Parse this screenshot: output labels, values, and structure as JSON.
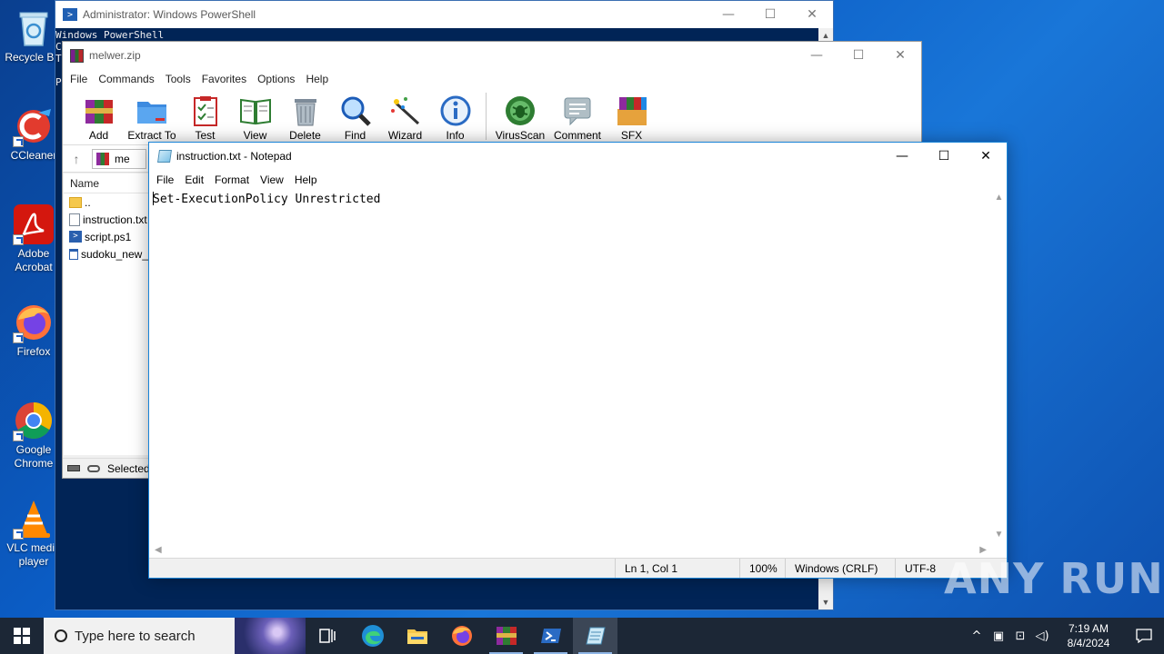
{
  "desktop": {
    "icons": [
      {
        "label": "Recycle Bin",
        "shortcut": false
      },
      {
        "label": "CCleaner",
        "shortcut": true
      },
      {
        "label": "Adobe Acrobat",
        "shortcut": true
      },
      {
        "label": "Firefox",
        "shortcut": true
      },
      {
        "label": "Google Chrome",
        "shortcut": true
      },
      {
        "label": "VLC media player",
        "shortcut": true
      }
    ]
  },
  "powershell": {
    "title": "Administrator: Windows PowerShell",
    "lines": [
      "Windows PowerShell",
      "C",
      "T",
      "",
      "P"
    ]
  },
  "winrar": {
    "title": "melwer.zip",
    "menu": [
      "File",
      "Commands",
      "Tools",
      "Favorites",
      "Options",
      "Help"
    ],
    "tools": [
      "Add",
      "Extract To",
      "Test",
      "View",
      "Delete",
      "Find",
      "Wizard",
      "Info",
      "VirusScan",
      "Comment",
      "SFX"
    ],
    "path_text": "me",
    "column_name": "Name",
    "files": [
      "..",
      "instruction.txt",
      "script.ps1",
      "sudoku_new_"
    ],
    "status": "Selected"
  },
  "notepad": {
    "title": "instruction.txt - Notepad",
    "menu": [
      "File",
      "Edit",
      "Format",
      "View",
      "Help"
    ],
    "content": "Set-ExecutionPolicy Unrestricted",
    "status": {
      "position": "Ln 1, Col 1",
      "zoom": "100%",
      "line_ending": "Windows (CRLF)",
      "encoding": "UTF-8"
    }
  },
  "watermark": "ANY RUN",
  "taskbar": {
    "search_placeholder": "Type here to search",
    "time": "7:19 AM",
    "date": "8/4/2024"
  },
  "colors": {
    "powershell_bg": "#012456",
    "taskbar_bg": "#1c2736",
    "accent": "#1883d7"
  }
}
